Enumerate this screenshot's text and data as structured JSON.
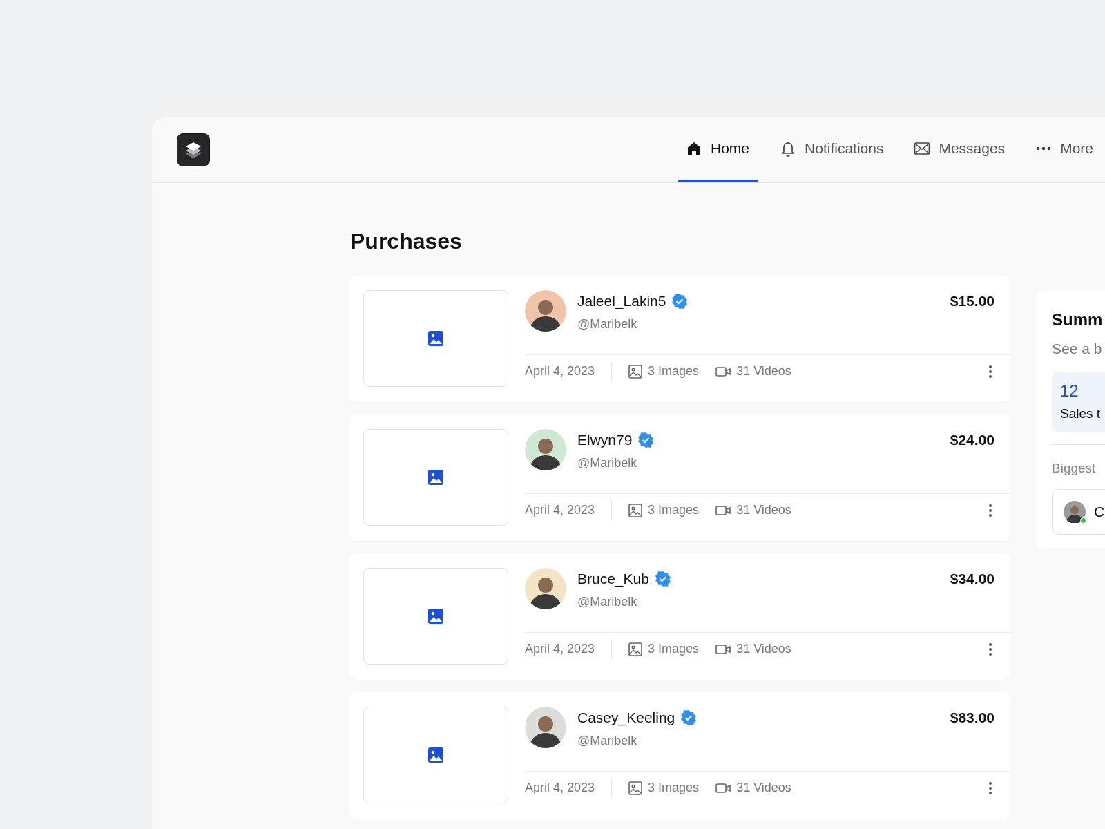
{
  "nav": [
    {
      "label": "Home",
      "kind": "home",
      "selected": true
    },
    {
      "label": "Notifications",
      "kind": "bell",
      "selected": false
    },
    {
      "label": "Messages",
      "kind": "mail",
      "selected": false
    },
    {
      "label": "More",
      "kind": "dots",
      "selected": false
    }
  ],
  "title": "Purchases",
  "purchases": [
    {
      "name": "Jaleel_Lakin5",
      "verified": true,
      "handle": "@Maribelk",
      "price": "$15.00",
      "date": "April 4, 2023",
      "images": "3 Images",
      "videos": "31 Videos",
      "color": "#f0c4a8"
    },
    {
      "name": "Elwyn79",
      "verified": true,
      "handle": "@Maribelk",
      "price": "$24.00",
      "date": "April 4, 2023",
      "images": "3 Images",
      "videos": "31 Videos",
      "color": "#cfe8d4"
    },
    {
      "name": "Bruce_Kub",
      "verified": true,
      "handle": "@Maribelk",
      "price": "$34.00",
      "date": "April 4, 2023",
      "images": "3 Images",
      "videos": "31 Videos",
      "color": "#f3e4c4"
    },
    {
      "name": "Casey_Keeling",
      "verified": true,
      "handle": "@Maribelk",
      "price": "$83.00",
      "date": "April 4, 2023",
      "images": "3 Images",
      "videos": "31 Videos",
      "color": "#dcdcd8"
    }
  ],
  "summary": {
    "title": "Summ",
    "subtitle": "See a b",
    "stat": {
      "value": "12",
      "label": "Sales t"
    },
    "section": "Biggest",
    "seller": {
      "name": "C",
      "online": true
    }
  }
}
